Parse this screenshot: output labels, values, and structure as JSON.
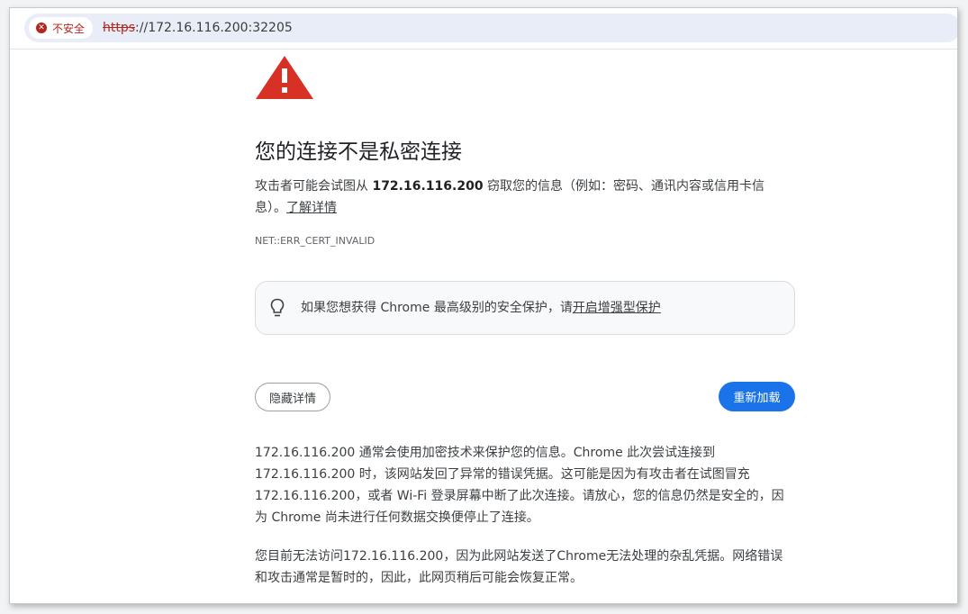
{
  "browser": {
    "security_chip_label": "不安全",
    "url_scheme": "https",
    "url_rest": "://172.16.116.200:32205"
  },
  "page": {
    "title": "您的连接不是私密连接",
    "intro_before": "攻击者可能会试图从 ",
    "intro_host": "172.16.116.200",
    "intro_after": " 窃取您的信息（例如：密码、通讯内容或信用卡信息）。",
    "learn_more": "了解详情",
    "error_code": "NET::ERR_CERT_INVALID",
    "enhanced_text": "如果您想获得 Chrome 最高级别的安全保护，请",
    "enhanced_link": "开启增强型保护",
    "details_button": "隐藏详情",
    "reload_button": "重新加载",
    "detail_paragraph_1": "172.16.116.200 通常会使用加密技术来保护您的信息。Chrome 此次尝试连接到 172.16.116.200 时，该网站发回了异常的错误凭据。这可能是因为有攻击者在试图冒充 172.16.116.200，或者 Wi-Fi 登录屏幕中断了此次连接。请放心，您的信息仍然是安全的，因为 Chrome 尚未进行任何数据交换便停止了连接。",
    "detail_paragraph_2": "您目前无法访问172.16.116.200，因为此网站发送了Chrome无法处理的杂乱凭据。网络错误和攻击通常是暂时的，因此，此网页稍后可能会恢复正常。"
  },
  "colors": {
    "warning_red": "#d93025",
    "not_secure_red": "#b3261e",
    "reload_blue": "#1a73e8"
  },
  "icons": {
    "warning": "warning-triangle-icon",
    "error": "error-circle-icon",
    "lightbulb": "lightbulb-icon"
  }
}
